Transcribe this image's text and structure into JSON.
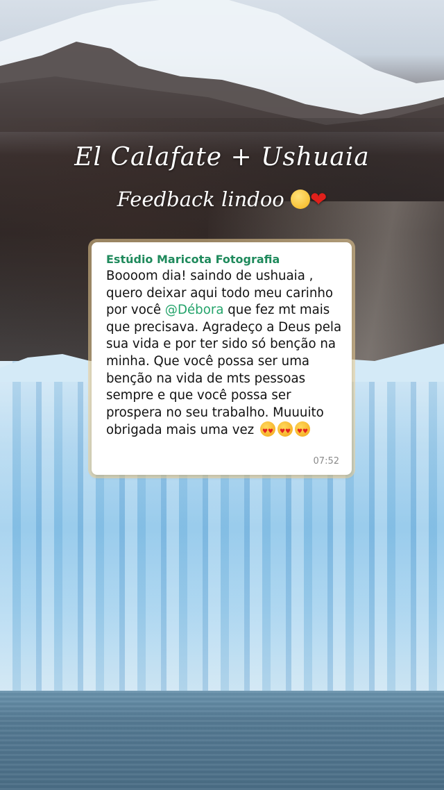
{
  "story": {
    "title": "El Calafate + Ushuaia",
    "subtitle": "Feedback lindoo",
    "subtitle_emojis": [
      "pleading-face",
      "red-heart"
    ]
  },
  "message": {
    "sender": "Estúdio Maricota Fotografia",
    "text_before": "Boooom dia! saindo de ushuaia , quero deixar aqui todo meu carinho por você ",
    "mention": "@Débora",
    "text_after": " que fez mt mais que precisava. Agradeço a Deus pela sua vida e por ter sido só benção na minha. Que você possa ser uma benção na vida de mts pessoas sempre e que você possa ser prospera no seu trabalho. Muuuito obrigada mais uma vez",
    "trailing_emojis": [
      "heart-eyes",
      "heart-eyes",
      "heart-eyes"
    ],
    "time": "07:52"
  },
  "colors": {
    "sender": "#1f8a5c",
    "mention": "#23a36a",
    "heart": "#e0201b"
  }
}
